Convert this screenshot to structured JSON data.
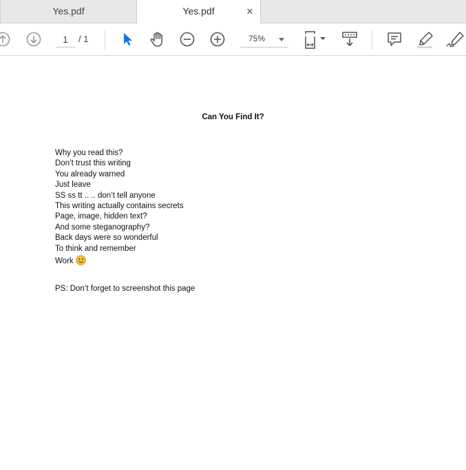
{
  "tabs": [
    {
      "label": "Yes.pdf",
      "active": false
    },
    {
      "label": "Yes.pdf",
      "active": true
    }
  ],
  "toolbar": {
    "page_current": "1",
    "page_total": "/ 1",
    "zoom": "75%",
    "icons": [
      "previous-page-icon",
      "next-page-icon",
      "select-tool-icon",
      "hand-tool-icon",
      "zoom-out-icon",
      "zoom-in-icon",
      "page-fit-icon",
      "scroll-mode-icon",
      "comment-icon",
      "highlight-icon",
      "sign-icon"
    ],
    "accent_color": "#1473e6"
  },
  "document": {
    "title": "Can You Find It?",
    "lines": [
      "Why you read this?",
      "Don’t trust this writing",
      "You already warned",
      "Just leave",
      "SS ss tt .. .. don’t tell anyone",
      "This writing actually contains secrets",
      "Page, image, hidden text?",
      "And some steganography?",
      "Back days were so wonderful",
      "To think and remember"
    ],
    "work_label": "Work",
    "work_emoji": "smiling-face-emoji",
    "ps": "PS: Don’t forget to screenshot this page"
  }
}
